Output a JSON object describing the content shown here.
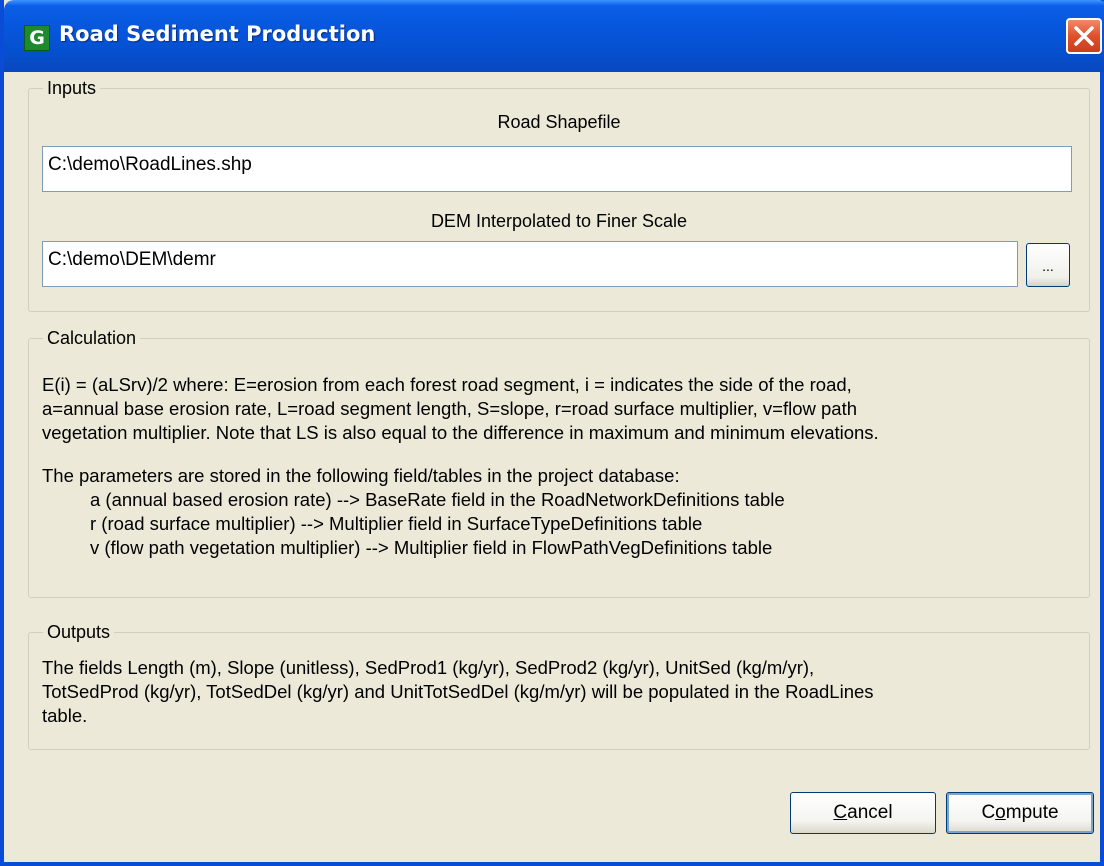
{
  "window": {
    "title": "Road Sediment Production",
    "app_icon_letter": "G",
    "close_icon": "close-icon"
  },
  "inputs": {
    "legend": "Inputs",
    "road_label": "Road Shapefile",
    "road_value": "C:\\demo\\RoadLines.shp",
    "dem_label": "DEM Interpolated to Finer Scale",
    "dem_value": "C:\\demo\\DEM\\demr",
    "browse_label": "..."
  },
  "calculation": {
    "legend": "Calculation",
    "lines": [
      "E(i) = (aLSrv)/2  where:  E=erosion from each forest road segment,  i = indicates the side of the road,",
      "a=annual base erosion rate, L=road segment length, S=slope, r=road surface multiplier, v=flow path",
      "vegetation multiplier.  Note that LS is also equal to the difference in maximum and minimum elevations.",
      "The parameters are stored in the following field/tables in the project database:",
      "a (annual based erosion rate) --> BaseRate field in the RoadNetworkDefinitions table",
      "r (road surface multiplier) --> Multiplier field in SurfaceTypeDefinitions table",
      "v (flow path vegetation multiplier) --> Multiplier field in FlowPathVegDefinitions table"
    ]
  },
  "outputs": {
    "legend": "Outputs",
    "lines": [
      "The fields Length (m), Slope (unitless), SedProd1 (kg/yr), SedProd2 (kg/yr), UnitSed (kg/m/yr),",
      "TotSedProd (kg/yr), TotSedDel (kg/yr) and UnitTotSedDel (kg/m/yr) will be populated in the RoadLines",
      "table."
    ]
  },
  "buttons": {
    "cancel_accel": "C",
    "cancel_rest": "ancel",
    "compute_first": "C",
    "compute_accel": "o",
    "compute_rest": "mpute"
  },
  "colors": {
    "titlebar": "#0450D0",
    "window_bg": "#ECE9D8",
    "close_button": "#E0502C"
  }
}
